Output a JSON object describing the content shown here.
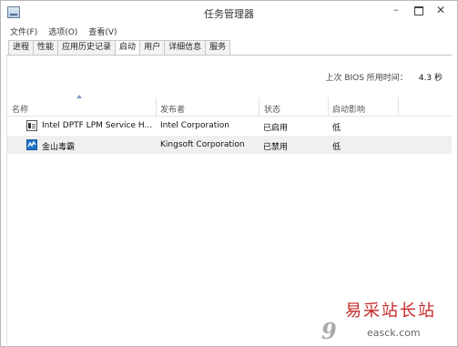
{
  "window": {
    "title": "任务管理器",
    "controls": {
      "minimize": "–",
      "close": "✕"
    }
  },
  "menu": [
    "文件(F)",
    "选项(O)",
    "查看(V)"
  ],
  "tabs": [
    "进程",
    "性能",
    "应用历史记录",
    "启动",
    "用户",
    "详细信息",
    "服务"
  ],
  "active_tab": "启动",
  "bios": {
    "label": "上次 BIOS 所用时间：",
    "value": "4.3 秒"
  },
  "columns": {
    "name": "名称",
    "publisher": "发布者",
    "status": "状态",
    "impact": "启动影响"
  },
  "rows": [
    {
      "icon": "app-window-icon",
      "name": "Intel DPTF LPM Service H...",
      "publisher": "Intel Corporation",
      "status": "已启用",
      "impact": "低"
    },
    {
      "icon": "kingsoft-antivirus-icon",
      "name": "金山毒霸",
      "publisher": "Kingsoft Corporation",
      "status": "已禁用",
      "impact": "低"
    }
  ],
  "watermark": {
    "main": "易采站长站",
    "sub": "easck.com",
    "logo": "9"
  }
}
